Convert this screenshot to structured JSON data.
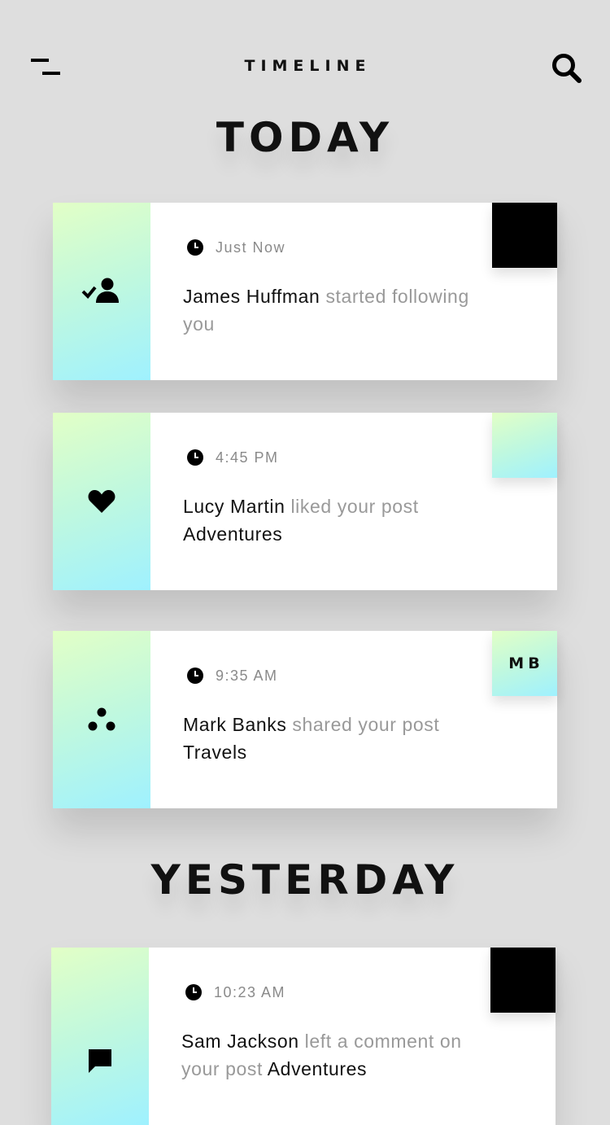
{
  "header": {
    "title": "TIMELINE",
    "menu_icon": "menu-icon",
    "search_icon": "search-icon"
  },
  "sections": [
    {
      "title": "TODAY",
      "items": [
        {
          "icon": "user-check-icon",
          "time": "Just Now",
          "actor": "James Huffman",
          "action": " started following you",
          "object": "",
          "corner": "black",
          "corner_text": ""
        },
        {
          "icon": "heart-icon",
          "time": "4:45 PM",
          "actor": "Lucy Martin",
          "action": " liked your post ",
          "object": "Adventures",
          "corner": "gradient",
          "corner_text": ""
        },
        {
          "icon": "share-icon",
          "time": "9:35 AM",
          "actor": "Mark Banks",
          "action": " shared your post ",
          "object": "Travels",
          "corner": "gradient",
          "corner_text": "MB"
        }
      ]
    },
    {
      "title": "YESTERDAY",
      "items": [
        {
          "icon": "comment-icon",
          "time": "10:23 AM",
          "actor": "Sam Jackson",
          "action": " left a comment on your post ",
          "object": "Adventures",
          "corner": "black",
          "corner_text": ""
        }
      ]
    }
  ],
  "colors": {
    "background": "#dedede",
    "gradient_start": "#e2ffc6",
    "gradient_end": "#9ff1ff",
    "text_dark": "#111111",
    "text_muted": "#999999"
  }
}
